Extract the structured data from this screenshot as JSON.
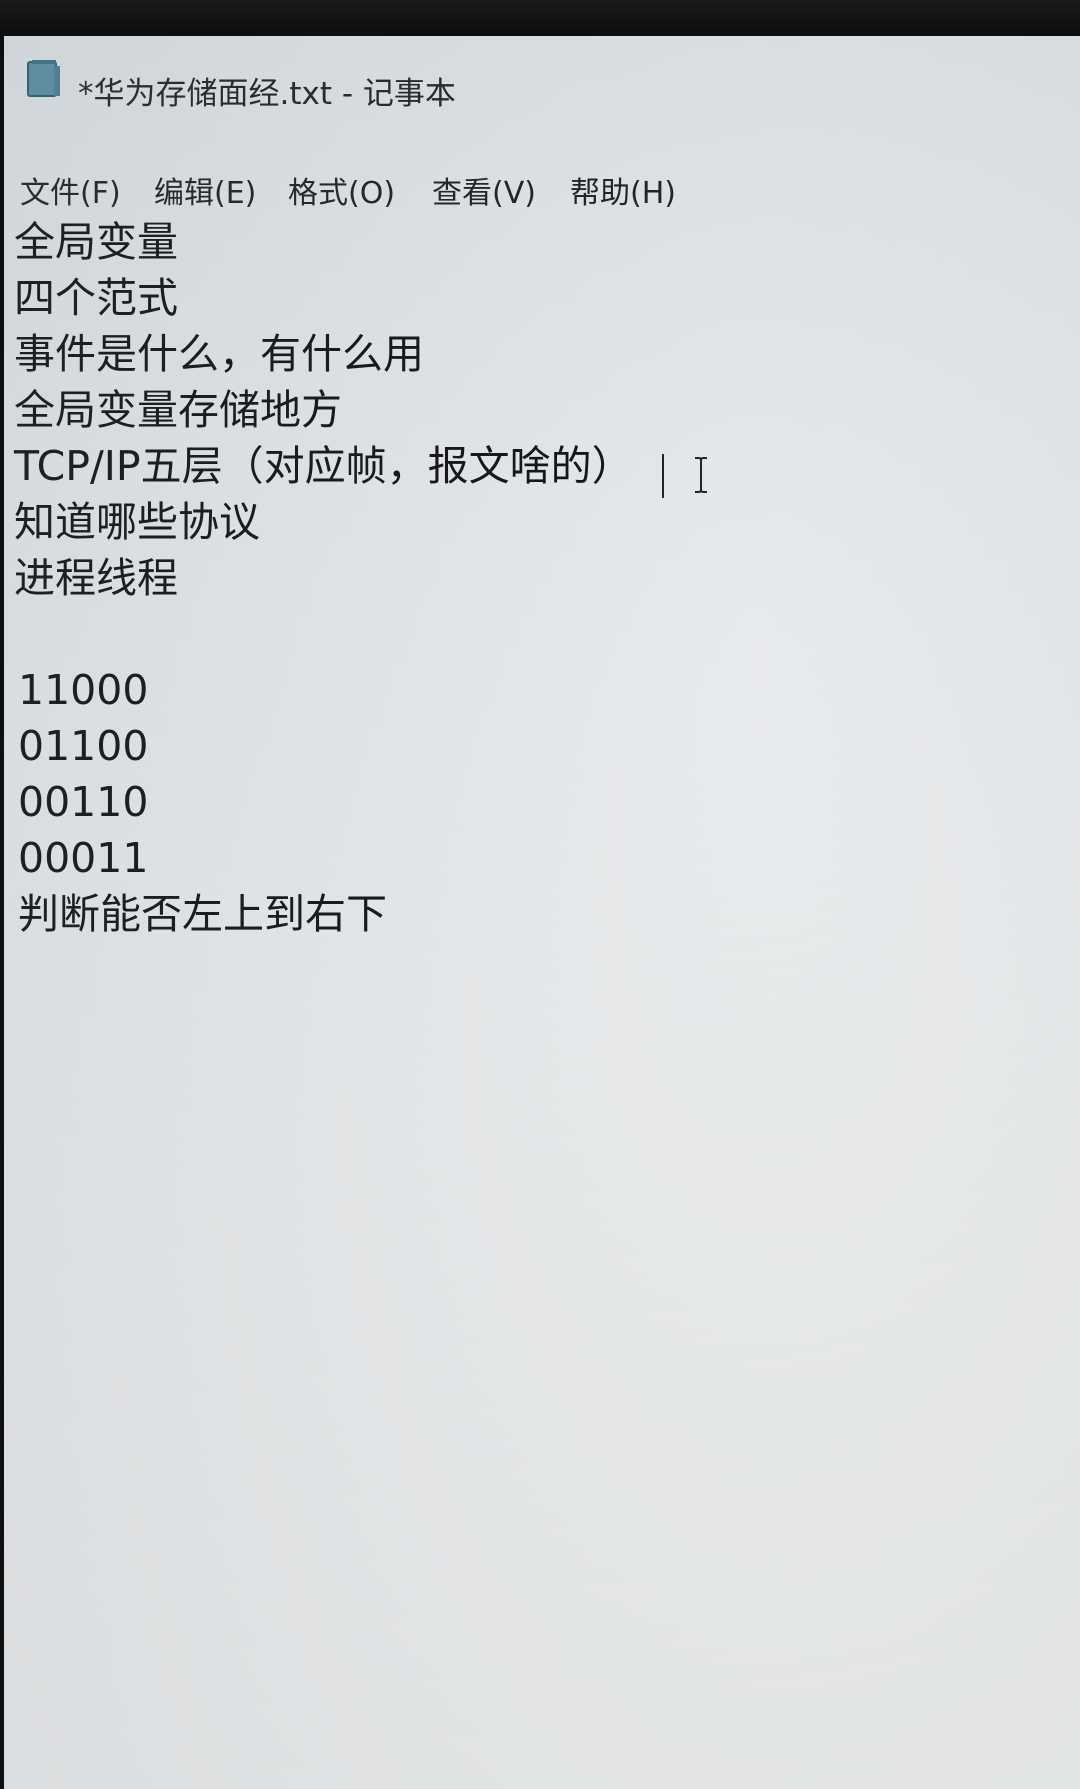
{
  "window": {
    "title": "*华为存储面经.txt - 记事本",
    "icon": "notepad-icon"
  },
  "menu": {
    "items": [
      {
        "label": "文件(F)"
      },
      {
        "label": "编辑(E)"
      },
      {
        "label": "格式(O)"
      },
      {
        "label": "查看(V)"
      },
      {
        "label": "帮助(H)"
      }
    ]
  },
  "editor": {
    "lines": [
      "全局变量",
      "四个范式",
      "事件是什么，有什么用",
      "全局变量存储地方",
      "TCP/IP五层（对应帧，报文啥的）",
      "知道哪些协议",
      "进程线程",
      "",
      "11000",
      "01100",
      "00110",
      "00011",
      "判断能否左上到右下"
    ],
    "cursor_icon": "text-cursor-icon"
  },
  "colors": {
    "background": "#e6e9ec",
    "text": "#121212"
  }
}
